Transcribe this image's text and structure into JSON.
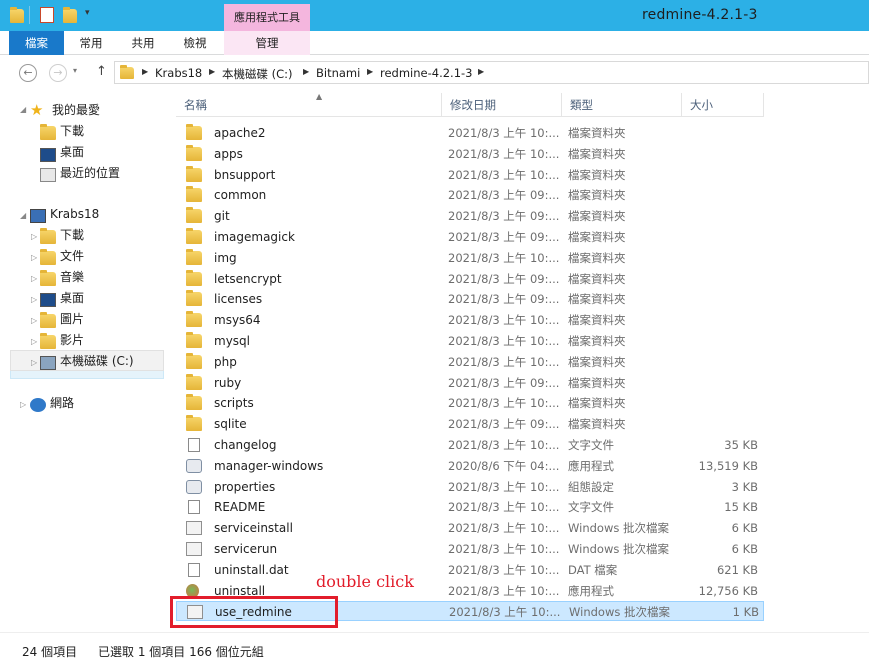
{
  "window": {
    "title": "redmine-4.2.1-3",
    "contextual_tab_group": "應用程式工具"
  },
  "ribbon": {
    "tabs": [
      {
        "label": "檔案"
      },
      {
        "label": "常用"
      },
      {
        "label": "共用"
      },
      {
        "label": "檢視"
      },
      {
        "label": "管理"
      }
    ]
  },
  "address": {
    "breadcrumbs": [
      "Krabs18",
      "本機磁碟 (C:)",
      "Bitnami",
      "redmine-4.2.1-3"
    ]
  },
  "nav_pane": {
    "favorites": {
      "label": "我的最愛",
      "items": [
        "下載",
        "桌面",
        "最近的位置"
      ]
    },
    "computer": {
      "label": "Krabs18",
      "items": [
        "下載",
        "文件",
        "音樂",
        "桌面",
        "圖片",
        "影片",
        "本機磁碟 (C:)"
      ]
    },
    "network": {
      "label": "網路"
    }
  },
  "columns": {
    "name": "名稱",
    "date": "修改日期",
    "type": "類型",
    "size": "大小"
  },
  "files": [
    {
      "name": "apache2",
      "date": "2021/8/3 上午 10:...",
      "type": "檔案資料夾",
      "size": "",
      "icon": "folder-icon"
    },
    {
      "name": "apps",
      "date": "2021/8/3 上午 10:...",
      "type": "檔案資料夾",
      "size": "",
      "icon": "folder-icon"
    },
    {
      "name": "bnsupport",
      "date": "2021/8/3 上午 10:...",
      "type": "檔案資料夾",
      "size": "",
      "icon": "folder-icon"
    },
    {
      "name": "common",
      "date": "2021/8/3 上午 09:...",
      "type": "檔案資料夾",
      "size": "",
      "icon": "folder-icon"
    },
    {
      "name": "git",
      "date": "2021/8/3 上午 09:...",
      "type": "檔案資料夾",
      "size": "",
      "icon": "folder-icon"
    },
    {
      "name": "imagemagick",
      "date": "2021/8/3 上午 09:...",
      "type": "檔案資料夾",
      "size": "",
      "icon": "folder-icon"
    },
    {
      "name": "img",
      "date": "2021/8/3 上午 10:...",
      "type": "檔案資料夾",
      "size": "",
      "icon": "folder-icon"
    },
    {
      "name": "letsencrypt",
      "date": "2021/8/3 上午 09:...",
      "type": "檔案資料夾",
      "size": "",
      "icon": "folder-icon"
    },
    {
      "name": "licenses",
      "date": "2021/8/3 上午 09:...",
      "type": "檔案資料夾",
      "size": "",
      "icon": "folder-icon"
    },
    {
      "name": "msys64",
      "date": "2021/8/3 上午 10:...",
      "type": "檔案資料夾",
      "size": "",
      "icon": "folder-icon"
    },
    {
      "name": "mysql",
      "date": "2021/8/3 上午 10:...",
      "type": "檔案資料夾",
      "size": "",
      "icon": "folder-icon"
    },
    {
      "name": "php",
      "date": "2021/8/3 上午 10:...",
      "type": "檔案資料夾",
      "size": "",
      "icon": "folder-icon"
    },
    {
      "name": "ruby",
      "date": "2021/8/3 上午 09:...",
      "type": "檔案資料夾",
      "size": "",
      "icon": "folder-icon"
    },
    {
      "name": "scripts",
      "date": "2021/8/3 上午 10:...",
      "type": "檔案資料夾",
      "size": "",
      "icon": "folder-icon"
    },
    {
      "name": "sqlite",
      "date": "2021/8/3 上午 09:...",
      "type": "檔案資料夾",
      "size": "",
      "icon": "folder-icon"
    },
    {
      "name": "changelog",
      "date": "2021/8/3 上午 10:...",
      "type": "文字文件",
      "size": "35 KB",
      "icon": "text-file-icon"
    },
    {
      "name": "manager-windows",
      "date": "2020/8/6 下午 04:...",
      "type": "應用程式",
      "size": "13,519 KB",
      "icon": "application-icon"
    },
    {
      "name": "properties",
      "date": "2021/8/3 上午 10:...",
      "type": "組態設定",
      "size": "3 KB",
      "icon": "config-file-icon"
    },
    {
      "name": "README",
      "date": "2021/8/3 上午 10:...",
      "type": "文字文件",
      "size": "15 KB",
      "icon": "text-file-icon"
    },
    {
      "name": "serviceinstall",
      "date": "2021/8/3 上午 10:...",
      "type": "Windows 批次檔案",
      "size": "6 KB",
      "icon": "batch-file-icon"
    },
    {
      "name": "servicerun",
      "date": "2021/8/3 上午 10:...",
      "type": "Windows 批次檔案",
      "size": "6 KB",
      "icon": "batch-file-icon"
    },
    {
      "name": "uninstall.dat",
      "date": "2021/8/3 上午 10:...",
      "type": "DAT 檔案",
      "size": "621 KB",
      "icon": "file-icon"
    },
    {
      "name": "uninstall",
      "date": "2021/8/3 上午 10:...",
      "type": "應用程式",
      "size": "12,756 KB",
      "icon": "uninstaller-icon"
    },
    {
      "name": "use_redmine",
      "date": "2021/8/3 上午 10:...",
      "type": "Windows 批次檔案",
      "size": "1 KB",
      "icon": "batch-file-icon",
      "selected": true
    }
  ],
  "annotation": {
    "text": "double click",
    "color": "#e21d2b"
  },
  "status": {
    "count": "24 個項目",
    "selection": "已選取 1 個項目  166 個位元組"
  },
  "colors": {
    "titlebar": "#2cb0e6",
    "file_tab": "#1979ca",
    "contextual_tab": "#f4b6de",
    "selection": "#cce8ff"
  }
}
